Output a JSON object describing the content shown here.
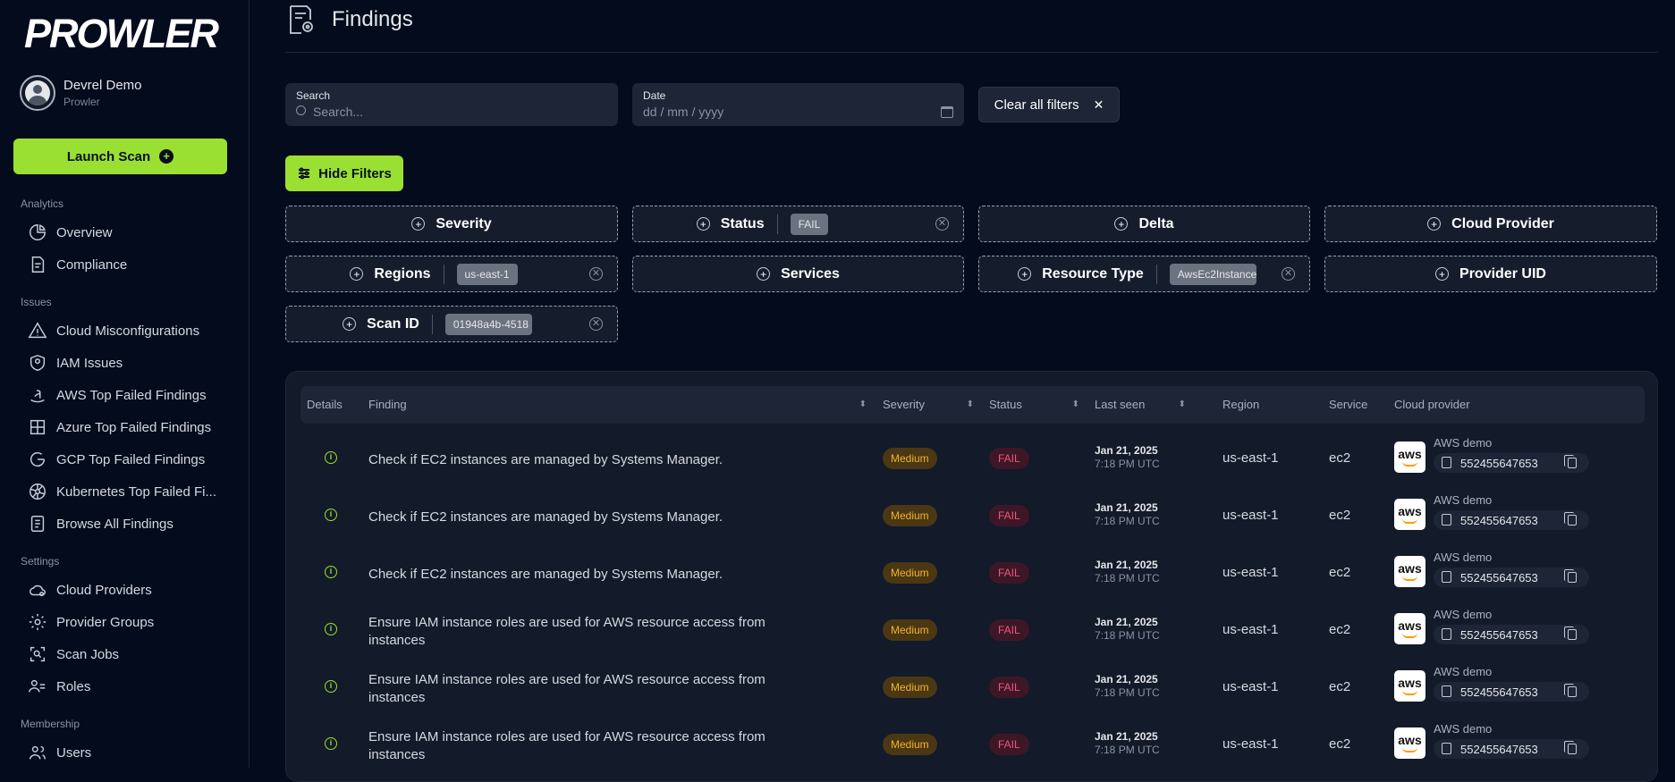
{
  "sidebar": {
    "logo": "PROWLER",
    "user": {
      "name": "Devrel Demo",
      "org": "Prowler"
    },
    "launch_label": "Launch Scan",
    "sections": {
      "analytics": "Analytics",
      "issues": "Issues",
      "settings": "Settings",
      "membership": "Membership"
    },
    "items": {
      "overview": "Overview",
      "compliance": "Compliance",
      "cloud_misconfig": "Cloud Misconfigurations",
      "iam_issues": "IAM Issues",
      "aws_top": "AWS Top Failed Findings",
      "azure_top": "Azure Top Failed Findings",
      "gcp_top": "GCP Top Failed Findings",
      "k8s_top": "Kubernetes Top Failed Fi...",
      "browse_all": "Browse All Findings",
      "cloud_providers": "Cloud Providers",
      "provider_groups": "Provider Groups",
      "scan_jobs": "Scan Jobs",
      "roles": "Roles",
      "users": "Users"
    }
  },
  "header": {
    "title": "Findings"
  },
  "filters_bar": {
    "search_label": "Search",
    "search_placeholder": "Search...",
    "date_label": "Date",
    "date_placeholder": "dd / mm / yyyy",
    "clear_label": "Clear all filters",
    "hide_label": "Hide Filters"
  },
  "filters": {
    "severity": {
      "label": "Severity"
    },
    "status": {
      "label": "Status",
      "value": "FAIL"
    },
    "delta": {
      "label": "Delta"
    },
    "cloud_provider": {
      "label": "Cloud Provider"
    },
    "regions": {
      "label": "Regions",
      "value": "us-east-1"
    },
    "services": {
      "label": "Services"
    },
    "resource_type": {
      "label": "Resource Type",
      "value": "AwsEc2Instance"
    },
    "provider_uid": {
      "label": "Provider UID"
    },
    "scan_id": {
      "label": "Scan ID",
      "value": "01948a4b-4518"
    }
  },
  "table": {
    "headers": {
      "details": "Details",
      "finding": "Finding",
      "severity": "Severity",
      "status": "Status",
      "last_seen": "Last seen",
      "region": "Region",
      "service": "Service",
      "cloud_provider": "Cloud provider"
    },
    "rows": [
      {
        "finding": "Check if EC2 instances are managed by Systems Manager.",
        "severity": "Medium",
        "status": "FAIL",
        "date": "Jan 21, 2025",
        "time": "7:18 PM UTC",
        "region": "us-east-1",
        "service": "ec2",
        "provider_logo": "aws",
        "account_name": "AWS demo",
        "account_id": "552455647653"
      },
      {
        "finding": "Check if EC2 instances are managed by Systems Manager.",
        "severity": "Medium",
        "status": "FAIL",
        "date": "Jan 21, 2025",
        "time": "7:18 PM UTC",
        "region": "us-east-1",
        "service": "ec2",
        "provider_logo": "aws",
        "account_name": "AWS demo",
        "account_id": "552455647653"
      },
      {
        "finding": "Check if EC2 instances are managed by Systems Manager.",
        "severity": "Medium",
        "status": "FAIL",
        "date": "Jan 21, 2025",
        "time": "7:18 PM UTC",
        "region": "us-east-1",
        "service": "ec2",
        "provider_logo": "aws",
        "account_name": "AWS demo",
        "account_id": "552455647653"
      },
      {
        "finding": "Ensure IAM instance roles are used for AWS resource access from instances",
        "severity": "Medium",
        "status": "FAIL",
        "date": "Jan 21, 2025",
        "time": "7:18 PM UTC",
        "region": "us-east-1",
        "service": "ec2",
        "provider_logo": "aws",
        "account_name": "AWS demo",
        "account_id": "552455647653"
      },
      {
        "finding": "Ensure IAM instance roles are used for AWS resource access from instances",
        "severity": "Medium",
        "status": "FAIL",
        "date": "Jan 21, 2025",
        "time": "7:18 PM UTC",
        "region": "us-east-1",
        "service": "ec2",
        "provider_logo": "aws",
        "account_name": "AWS demo",
        "account_id": "552455647653"
      },
      {
        "finding": "Ensure IAM instance roles are used for AWS resource access from instances",
        "severity": "Medium",
        "status": "FAIL",
        "date": "Jan 21, 2025",
        "time": "7:18 PM UTC",
        "region": "us-east-1",
        "service": "ec2",
        "provider_logo": "aws",
        "account_name": "AWS demo",
        "account_id": "552455647653"
      }
    ]
  }
}
